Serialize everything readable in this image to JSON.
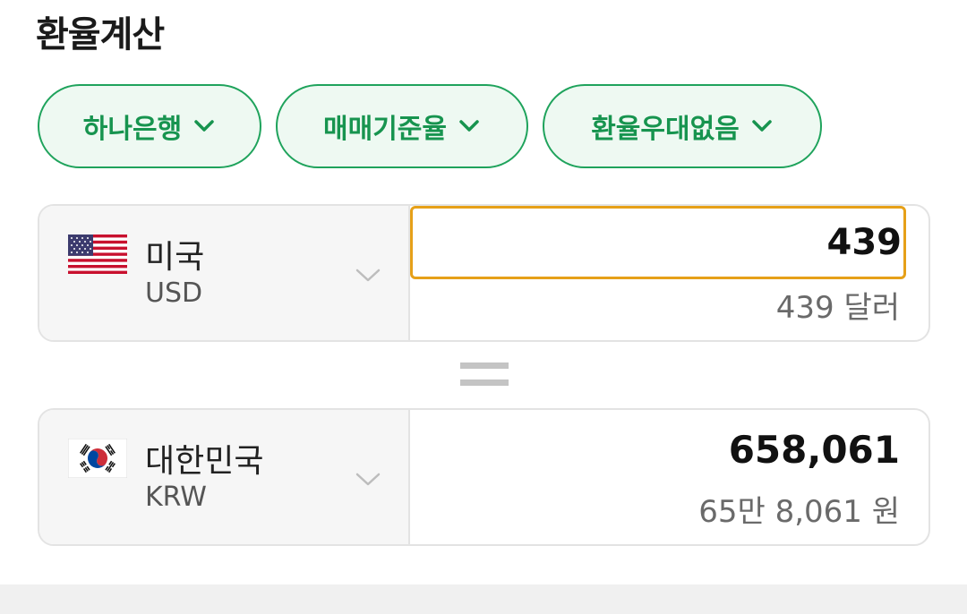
{
  "header": {
    "title": "환율계산"
  },
  "filters": [
    {
      "label": "하나은행",
      "icon": "chevron-down-icon"
    },
    {
      "label": "매매기준율",
      "icon": "chevron-down-icon"
    },
    {
      "label": "환율우대없음",
      "icon": "chevron-down-icon"
    }
  ],
  "from": {
    "country": "미국",
    "code": "USD",
    "flag": "us-flag-icon",
    "amount": "439",
    "amount_words": "439 달러"
  },
  "to": {
    "country": "대한민국",
    "code": "KRW",
    "flag": "kr-flag-icon",
    "amount": "658,061",
    "amount_words": "65만 8,061 원"
  },
  "colors": {
    "accent_green": "#17944f",
    "pill_bg": "#eef9f2",
    "focus_border": "#e6a018"
  }
}
